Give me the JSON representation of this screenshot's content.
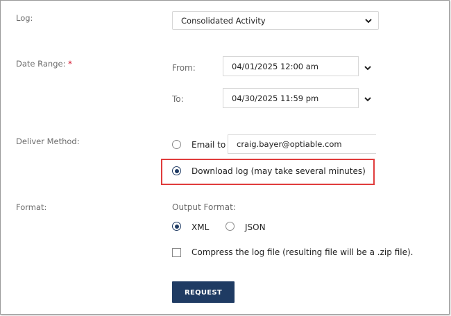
{
  "log": {
    "label": "Log:",
    "selected": "Consolidated Activity"
  },
  "date_range": {
    "label": "Date Range:",
    "required_marker": "*",
    "from_label": "From:",
    "from_value": "04/01/2025 12:00 am",
    "to_label": "To:",
    "to_value": "04/30/2025 11:59 pm"
  },
  "deliver": {
    "label": "Deliver Method:",
    "email_label": "Email to",
    "email_value": "craig.bayer@optiable.com",
    "download_label": "Download log (may take several minutes)",
    "selected": "download"
  },
  "format": {
    "label": "Format:",
    "output_label": "Output Format:",
    "options": [
      "XML",
      "JSON"
    ],
    "selected": "XML",
    "compress_label": "Compress the log file (resulting file will be a .zip file).",
    "compress_checked": false
  },
  "request_button": "REQUEST",
  "colors": {
    "accent": "#1f3b63",
    "required": "#d0021b",
    "highlight": "#e03c3c"
  },
  "icons": {
    "dropdown": "chevron-down-icon"
  }
}
